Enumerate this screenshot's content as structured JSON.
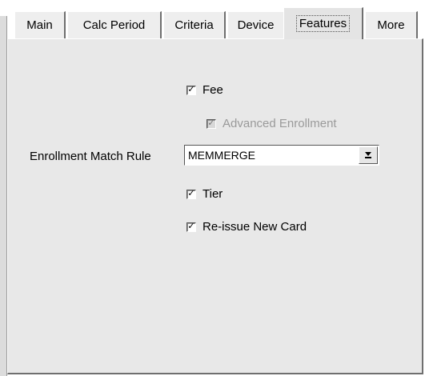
{
  "tabs": [
    {
      "label": "Main"
    },
    {
      "label": "Calc Period"
    },
    {
      "label": "Criteria"
    },
    {
      "label": "Device"
    },
    {
      "label": "Features",
      "selected": true
    },
    {
      "label": "More"
    }
  ],
  "features": {
    "fee": {
      "label": "Fee",
      "checked": true
    },
    "advanced_enrollment": {
      "label": "Advanced Enrollment",
      "checked": true,
      "disabled": true
    },
    "enrollment_match_rule": {
      "label": "Enrollment Match Rule",
      "value": "MEMMERGE"
    },
    "tier": {
      "label": "Tier",
      "checked": true
    },
    "reissue_new_card": {
      "label": "Re-issue New Card",
      "checked": true
    }
  },
  "icons": {
    "checkmark": "check-icon",
    "dropdown": "chevron-down-icon"
  }
}
